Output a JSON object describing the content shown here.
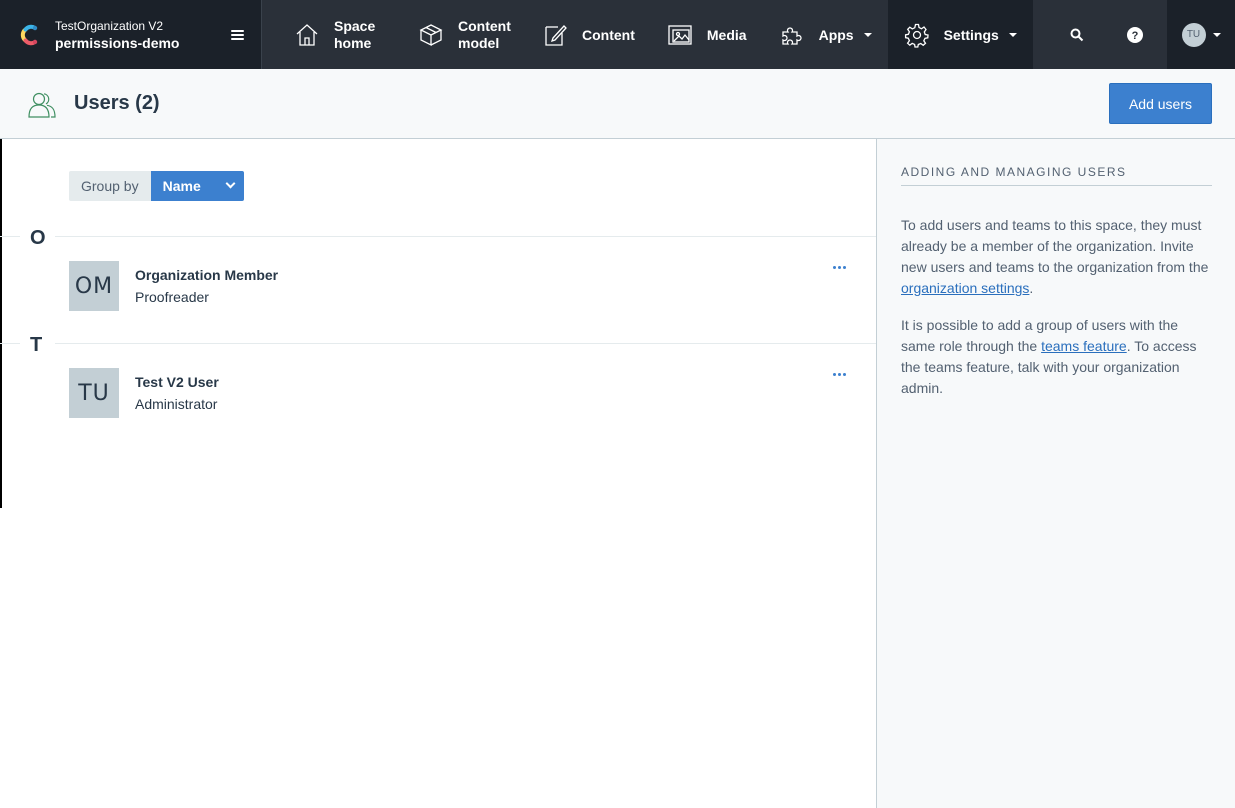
{
  "topbar": {
    "org_name": "TestOrganization V2",
    "space_name": "permissions-demo",
    "nav": [
      {
        "label_line1": "Space",
        "label_line2": "home",
        "icon": "home-icon"
      },
      {
        "label_line1": "Content",
        "label_line2": "model",
        "icon": "content-model-icon"
      },
      {
        "label": "Content",
        "icon": "edit-icon"
      },
      {
        "label": "Media",
        "icon": "media-icon"
      },
      {
        "label": "Apps",
        "icon": "puzzle-icon"
      },
      {
        "label": "Settings",
        "icon": "gear-icon"
      }
    ],
    "account_initials": "TU"
  },
  "header": {
    "title": "Users (2)",
    "add_users_label": "Add users"
  },
  "groupby": {
    "label": "Group by",
    "selected": "Name"
  },
  "groups": [
    {
      "letter": "O",
      "users": [
        {
          "initials": "OM",
          "name": "Organization Member",
          "role": "Proofreader"
        }
      ]
    },
    {
      "letter": "T",
      "users": [
        {
          "initials": "TU",
          "name": "Test V2 User",
          "role": "Administrator"
        }
      ]
    }
  ],
  "sidebar": {
    "heading": "ADDING AND MANAGING USERS",
    "p1_text": "To add users and teams to this space, they must already be a member of the organization. Invite new users and teams to the organization from the ",
    "p1_link": "organization settings",
    "p1_end": ".",
    "p2_text": "It is possible to add a group of users with the same role through the ",
    "p2_link": "teams feature",
    "p2_end": ". To access the teams feature, talk with your organization admin."
  },
  "colors": {
    "nav_bg": "#2a3039",
    "nav_dark": "#1b2129",
    "primary": "#3c80cf",
    "avatar_bg": "#c3cfd5"
  }
}
